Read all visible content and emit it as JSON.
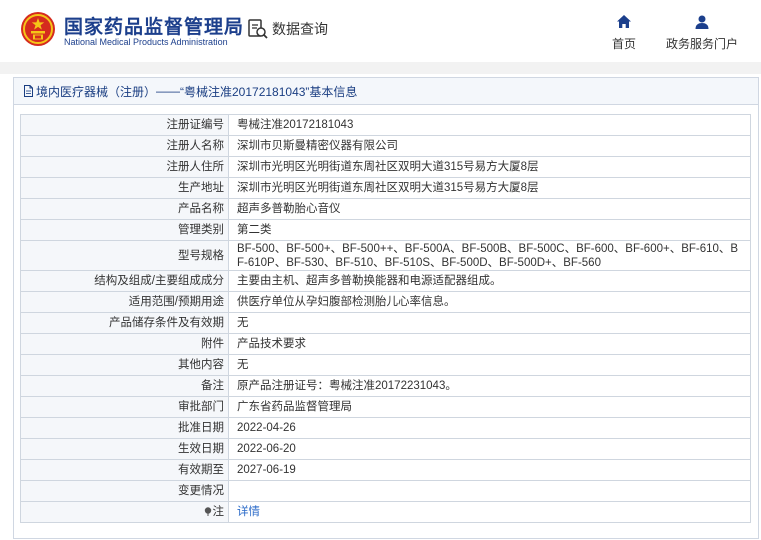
{
  "header": {
    "brand_cn": "国家药品监督管理局",
    "brand_en": "National Medical Products Administration",
    "query_label": "数据查询",
    "nav": {
      "home": "首页",
      "services": "政务服务门户"
    }
  },
  "breadcrumb": {
    "link": "境内医疗器械（注册）",
    "sep": "——",
    "title": "“粤械注准20172181043”基本信息"
  },
  "rows": [
    {
      "label": "注册证编号",
      "value": "粤械注准20172181043"
    },
    {
      "label": "注册人名称",
      "value": "深圳市贝斯曼精密仪器有限公司"
    },
    {
      "label": "注册人住所",
      "value": "深圳市光明区光明街道东周社区双明大道315号易方大厦8层"
    },
    {
      "label": "生产地址",
      "value": "深圳市光明区光明街道东周社区双明大道315号易方大厦8层"
    },
    {
      "label": "产品名称",
      "value": "超声多普勒胎心音仪"
    },
    {
      "label": "管理类别",
      "value": "第二类"
    },
    {
      "label": "型号规格",
      "value": "BF-500、BF-500+、BF-500++、BF-500A、BF-500B、BF-500C、BF-600、BF-600+、BF-610、BF-610P、BF-530、BF-510、BF-510S、BF-500D、BF-500D+、BF-560"
    },
    {
      "label": "结构及组成/主要组成成分",
      "value": "主要由主机、超声多普勒换能器和电源适配器组成。"
    },
    {
      "label": "适用范围/预期用途",
      "value": "供医疗单位从孕妇腹部检测胎儿心率信息。"
    },
    {
      "label": "产品储存条件及有效期",
      "value": "无"
    },
    {
      "label": "附件",
      "value": "产品技术要求"
    },
    {
      "label": "其他内容",
      "value": "无"
    },
    {
      "label": "备注",
      "value": "原产品注册证号：粤械注准20172231043。"
    },
    {
      "label": "审批部门",
      "value": "广东省药品监督管理局"
    },
    {
      "label": "批准日期",
      "value": "2022-04-26"
    },
    {
      "label": "生效日期",
      "value": "2022-06-20"
    },
    {
      "label": "有效期至",
      "value": "2027-06-19"
    },
    {
      "label": "变更情况",
      "value": ""
    }
  ],
  "note": {
    "label": "注",
    "link": "详情"
  },
  "colors": {
    "brand": "#1c3f8c",
    "link": "#2a6ac8",
    "emblem_red": "#d52b1e",
    "emblem_gold": "#f5c518"
  },
  "icons": [
    "national-emblem-icon",
    "data-query-icon",
    "home-icon",
    "user-icon",
    "document-icon",
    "pin-icon"
  ]
}
